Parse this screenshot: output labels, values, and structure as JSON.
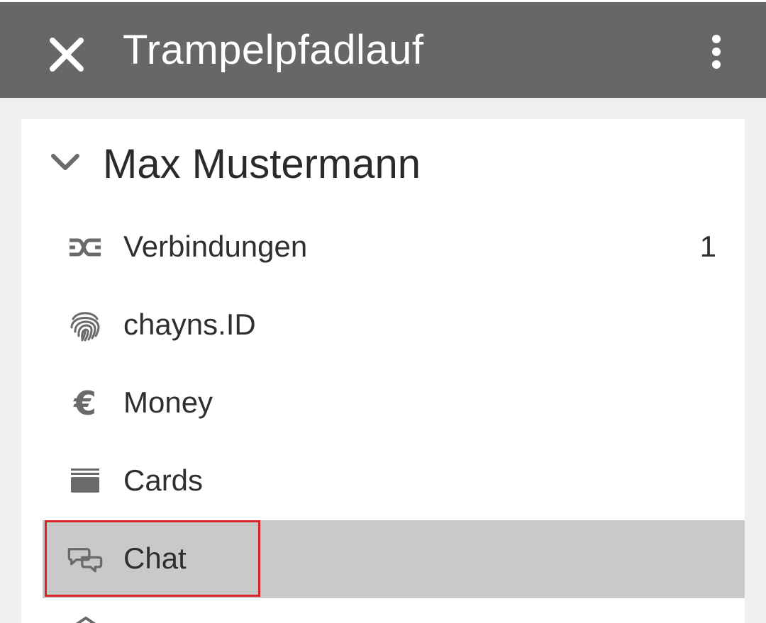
{
  "header": {
    "title": "Trampelpfadlauf",
    "close_icon": "close-icon",
    "menu_icon": "more-vertical-icon"
  },
  "profile": {
    "name": "Max Mustermann",
    "expand_icon": "chevron-down-icon"
  },
  "menu": {
    "items": [
      {
        "label": "Verbindungen",
        "icon": "connections-icon",
        "badge": "1"
      },
      {
        "label": "chayns.ID",
        "icon": "fingerprint-icon",
        "badge": ""
      },
      {
        "label": "Money",
        "icon": "euro-icon",
        "badge": ""
      },
      {
        "label": "Cards",
        "icon": "cards-icon",
        "badge": ""
      },
      {
        "label": "Chat",
        "icon": "chat-icon",
        "badge": "",
        "active": true
      }
    ]
  },
  "colors": {
    "topbar": "#676767",
    "active_row": "#c9c9c9",
    "highlight": "#d9242c",
    "icon": "#6a6a6a"
  }
}
